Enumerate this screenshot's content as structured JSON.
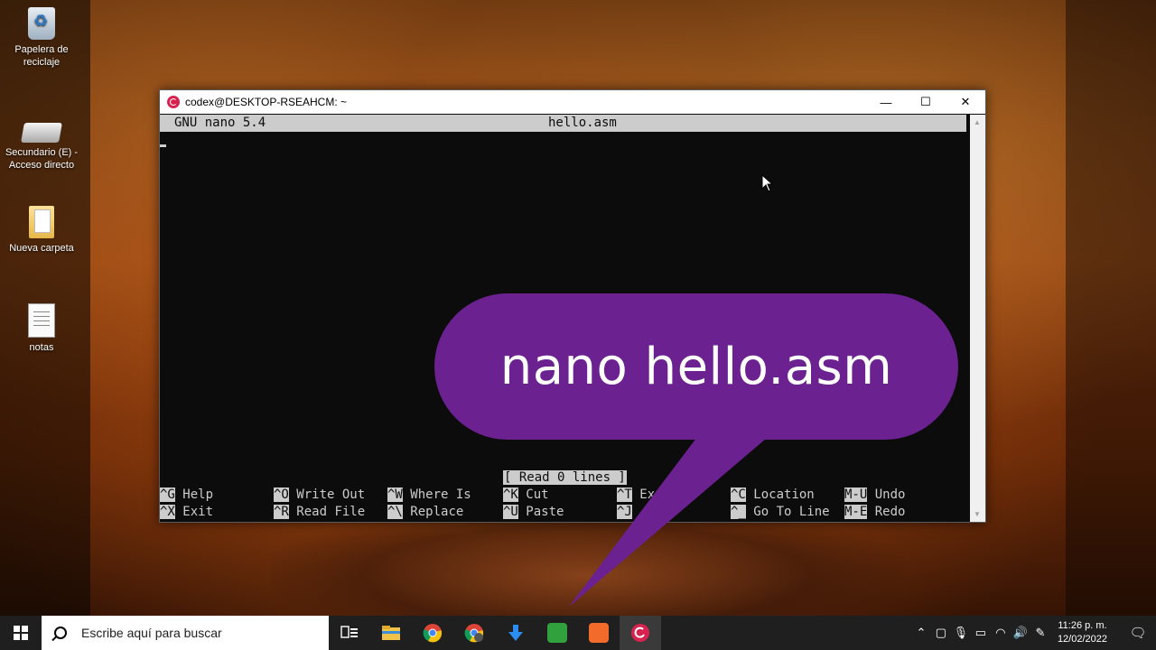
{
  "desktop": {
    "icons": [
      {
        "label": "Papelera de reciclaje"
      },
      {
        "label": "Secundario (E) - Acceso directo"
      },
      {
        "label": "Nueva carpeta"
      },
      {
        "label": "notas"
      }
    ]
  },
  "window": {
    "title": "codex@DESKTOP-RSEAHCM: ~",
    "minimize": "—",
    "maximize": "☐",
    "close": "✕"
  },
  "nano": {
    "version": "GNU nano 5.4",
    "filename": "hello.asm",
    "status": "[ Read 0 lines ]",
    "shortcuts": [
      {
        "key": "^G",
        "label": "Help"
      },
      {
        "key": "^O",
        "label": "Write Out"
      },
      {
        "key": "^W",
        "label": "Where Is"
      },
      {
        "key": "^K",
        "label": "Cut"
      },
      {
        "key": "^T",
        "label": "Ex"
      },
      {
        "key": "^C",
        "label": "Location"
      },
      {
        "key": "M-U",
        "label": "Undo"
      },
      {
        "key": "^X",
        "label": "Exit"
      },
      {
        "key": "^R",
        "label": "Read File"
      },
      {
        "key": "^\\",
        "label": "Replace"
      },
      {
        "key": "^U",
        "label": "Paste"
      },
      {
        "key": "^J",
        "label": ""
      },
      {
        "key": "^_",
        "label": "Go To Line"
      },
      {
        "key": "M-E",
        "label": "Redo"
      }
    ]
  },
  "overlay": {
    "bubble_text": "nano hello.asm",
    "bubble_color": "#6b2290"
  },
  "taskbar": {
    "search_placeholder": "Escribe aquí para buscar",
    "apps": [
      {
        "icon": "task-view-icon"
      },
      {
        "icon": "file-explorer-icon"
      },
      {
        "icon": "chrome-icon"
      },
      {
        "icon": "chrome-profile-icon"
      },
      {
        "icon": "download-icon"
      },
      {
        "icon": "camtasia-icon"
      },
      {
        "icon": "sublime-text-icon"
      },
      {
        "icon": "debian-icon"
      }
    ],
    "time": "11:26 p. m.",
    "date": "12/02/2022"
  }
}
